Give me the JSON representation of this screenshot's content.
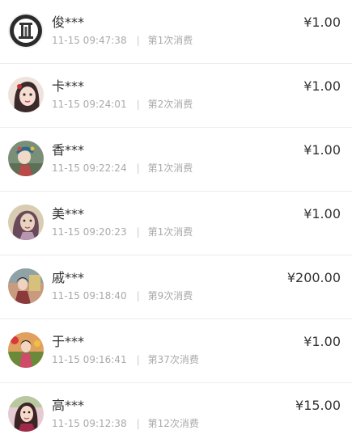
{
  "currency_symbol": "¥",
  "separator": "|",
  "records": [
    {
      "name": "俊***",
      "time": "11-15 09:47:38",
      "count_label": "第1次消费",
      "amount": "¥1.00",
      "avatar_icon": "emblem-avatar-icon",
      "avatar_bg": "#2b2b2b"
    },
    {
      "name": "卡***",
      "time": "11-15 09:24:01",
      "count_label": "第2次消费",
      "amount": "¥1.00",
      "avatar_icon": "anime-girl-avatar-icon",
      "avatar_bg": "#e9d7cf"
    },
    {
      "name": "香***",
      "time": "11-15 09:22:24",
      "count_label": "第1次消费",
      "amount": "¥1.00",
      "avatar_icon": "opera-costume-avatar-icon",
      "avatar_bg": "#6f8d6e"
    },
    {
      "name": "美***",
      "time": "11-15 09:20:23",
      "count_label": "第1次消费",
      "amount": "¥1.00",
      "avatar_icon": "woman-portrait-avatar-icon",
      "avatar_bg": "#cfc2a5"
    },
    {
      "name": "戚***",
      "time": "11-15 09:18:40",
      "count_label": "第9次消费",
      "amount": "¥200.00",
      "avatar_icon": "person-photo-avatar-icon",
      "avatar_bg": "#b57b6a"
    },
    {
      "name": "于***",
      "time": "11-15 09:16:41",
      "count_label": "第37次消费",
      "amount": "¥1.00",
      "avatar_icon": "flower-woman-avatar-icon",
      "avatar_bg": "#c56c3a"
    },
    {
      "name": "高***",
      "time": "11-15 09:12:38",
      "count_label": "第12次消费",
      "amount": "¥15.00",
      "avatar_icon": "girl-selfie-avatar-icon",
      "avatar_bg": "#d9b7c0"
    }
  ]
}
